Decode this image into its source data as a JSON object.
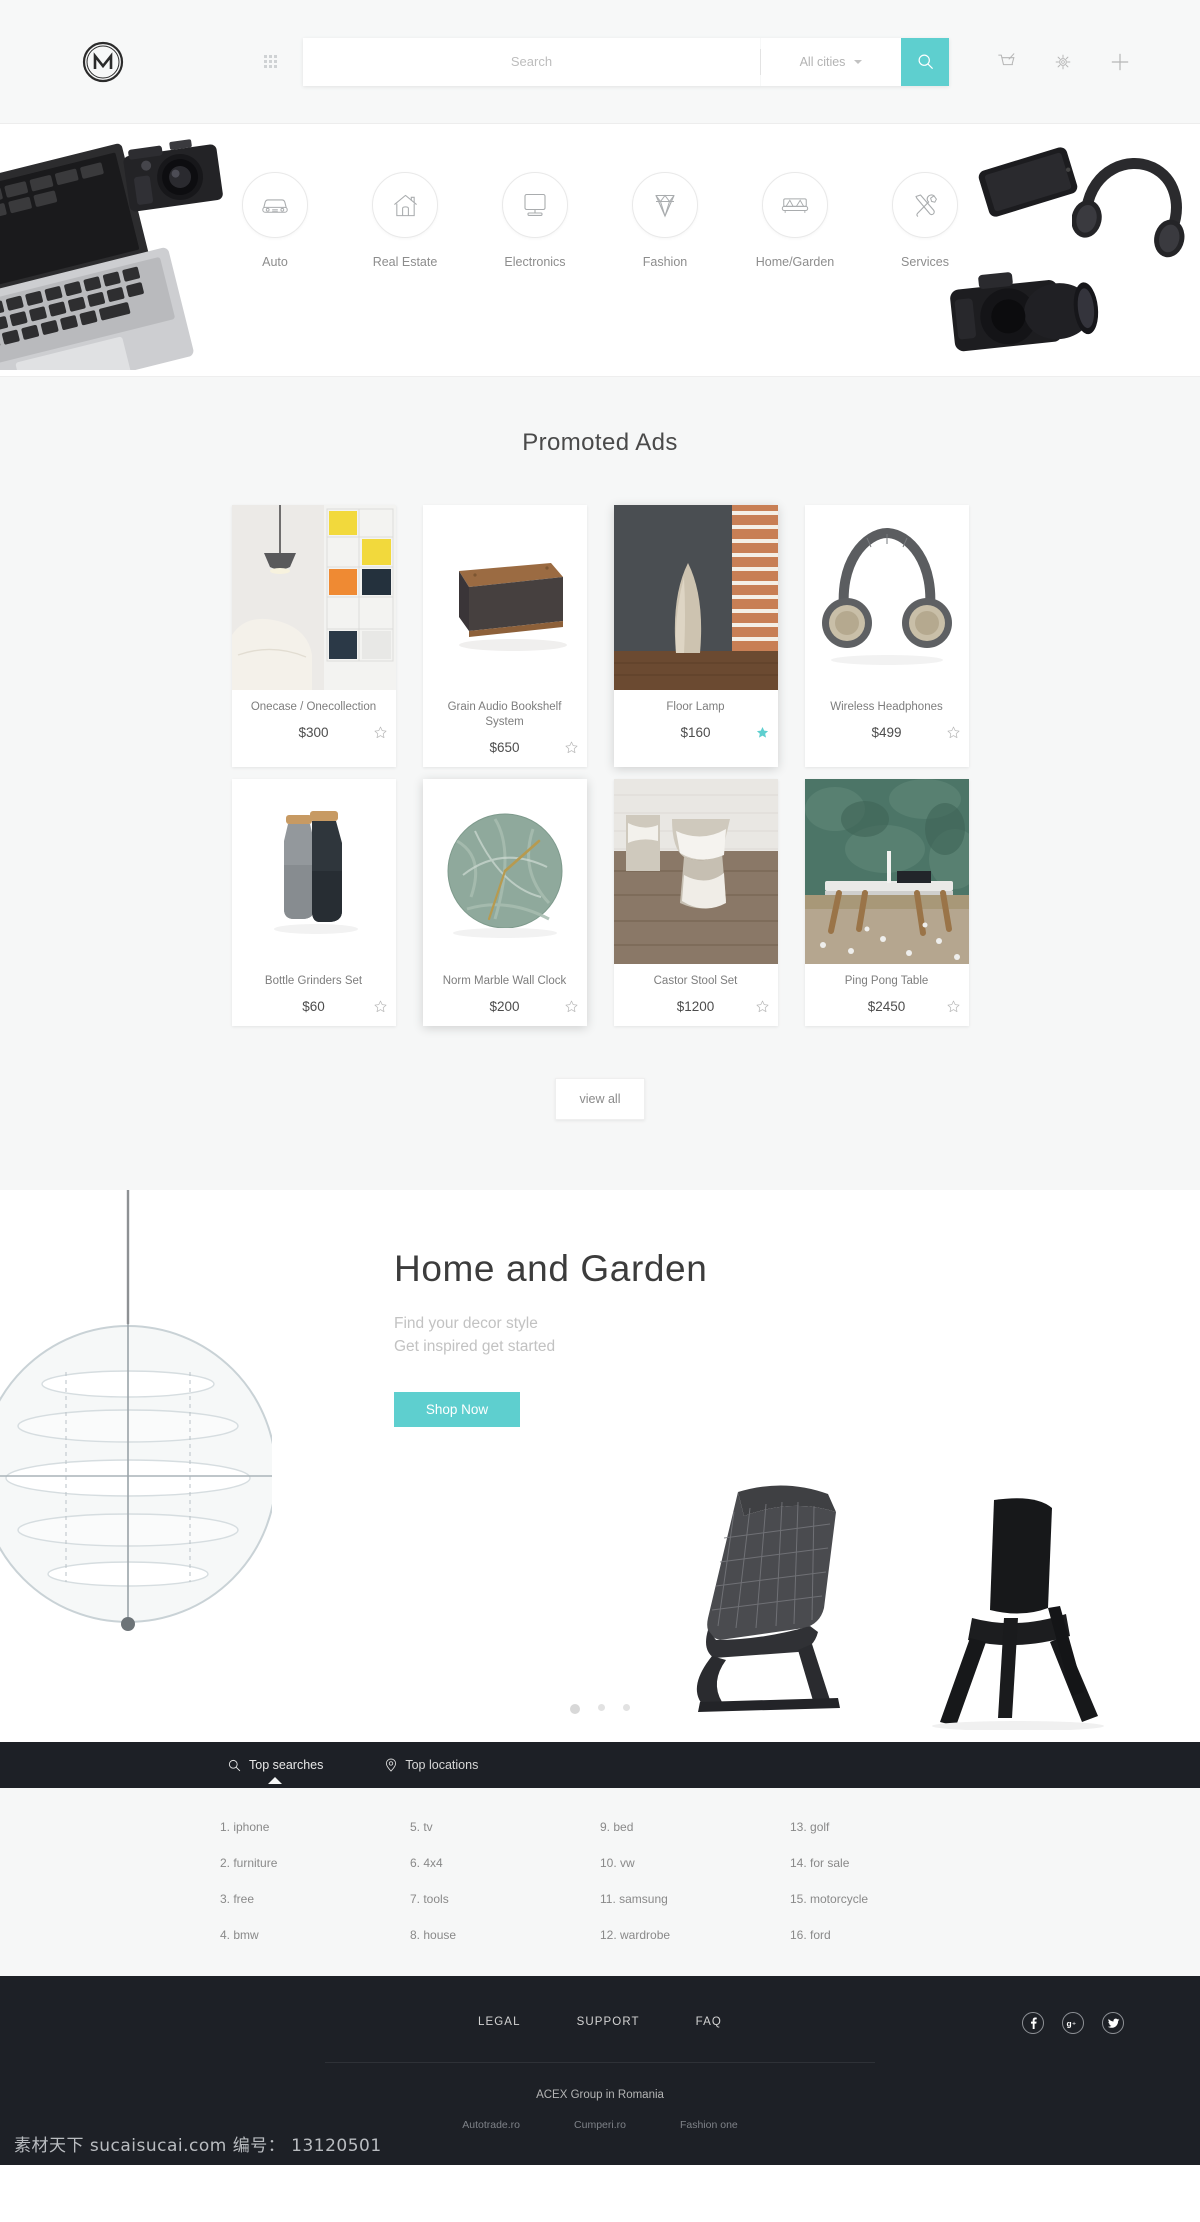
{
  "header": {
    "logo_letter": "M",
    "apps_icon": "grid-apps-icon",
    "search": {
      "placeholder": "Search",
      "value": ""
    },
    "city_select": {
      "label": "All cities",
      "icon": "chevron-down-icon"
    },
    "search_button_icon": "search-icon",
    "actions": [
      {
        "name": "cart-icon",
        "label": "Cart"
      },
      {
        "name": "gear-icon",
        "label": "Settings"
      },
      {
        "name": "plus-icon",
        "label": "Add"
      }
    ],
    "accent_color": "#5ecfcf"
  },
  "categories": [
    {
      "label": "Auto",
      "icon": "car-icon"
    },
    {
      "label": "Real Estate",
      "icon": "house-icon"
    },
    {
      "label": "Electronics",
      "icon": "monitor-icon"
    },
    {
      "label": "Fashion",
      "icon": "diamond-icon"
    },
    {
      "label": "Home/Garden",
      "icon": "sofa-icon"
    },
    {
      "label": "Services",
      "icon": "tools-icon"
    }
  ],
  "promoted": {
    "title": "Promoted Ads",
    "view_all_label": "view all",
    "items": [
      {
        "name": "Onecase / Onecollection",
        "price": "$300",
        "starred": false,
        "img": "interior-shelves"
      },
      {
        "name": "Grain Audio Bookshelf System",
        "price": "$650",
        "starred": false,
        "img": "wood-speaker"
      },
      {
        "name": "Floor Lamp",
        "price": "$160",
        "starred": true,
        "img": "floor-lamp"
      },
      {
        "name": "Wireless Headphones",
        "price": "$499",
        "starred": false,
        "img": "headphones"
      },
      {
        "name": "Bottle Grinders Set",
        "price": "$60",
        "starred": false,
        "img": "bottle-grinders"
      },
      {
        "name": "Norm Marble Wall Clock",
        "price": "$200",
        "starred": false,
        "img": "marble-clock"
      },
      {
        "name": "Castor Stool Set",
        "price": "$1200",
        "starred": false,
        "img": "castor-stools"
      },
      {
        "name": "Ping Pong Table",
        "price": "$2450",
        "starred": false,
        "img": "ping-pong-table"
      }
    ]
  },
  "hero": {
    "title": "Home and Garden",
    "subtitle_line1": "Find your decor style",
    "subtitle_line2": "Get inspired get started",
    "cta_label": "Shop Now",
    "dots": 3,
    "active_dot": 0
  },
  "top_section": {
    "tabs": [
      {
        "label": "Top searches",
        "icon": "search-icon",
        "active": true
      },
      {
        "label": "Top locations",
        "icon": "map-pin-icon",
        "active": false
      }
    ],
    "searches": [
      "1. iphone",
      "5. tv",
      "9. bed",
      "13. golf",
      "2. furniture",
      "6. 4x4",
      "10. vw",
      "14. for sale",
      "3. free",
      "7. tools",
      "11. samsung",
      "15. motorcycle",
      "4. bmw",
      "8. house",
      "12. wardrobe",
      "16. ford"
    ]
  },
  "footer": {
    "links": [
      "LEGAL",
      "SUPPORT",
      "FAQ"
    ],
    "social": [
      {
        "name": "facebook-icon",
        "glyph": "f"
      },
      {
        "name": "google-plus-icon",
        "glyph": "g+"
      },
      {
        "name": "twitter-icon",
        "glyph": "t"
      }
    ],
    "company": "ACEX Group in Romania",
    "brands": [
      "Autotrade.ro",
      "Cumperi.ro",
      "Fashion one"
    ],
    "watermark": "素材天下 sucaisucai.com  编号： 13120501"
  }
}
